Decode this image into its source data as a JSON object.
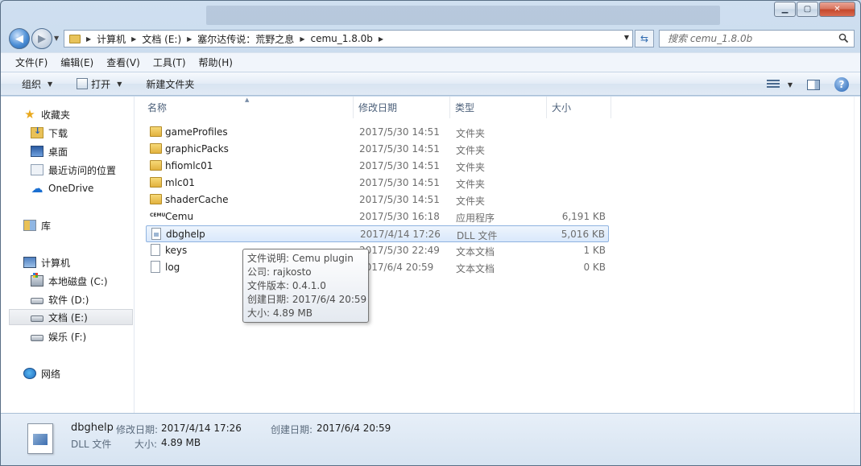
{
  "window": {
    "controls": {
      "minimize": "▁",
      "maximize": "▢",
      "close": "✕"
    }
  },
  "nav": {
    "back": "◀",
    "forward": "▶"
  },
  "address": {
    "crumbs": [
      "计算机",
      "文档 (E:)",
      "塞尔达传说：荒野之息",
      "cemu_1.8.0b"
    ]
  },
  "search": {
    "placeholder": "搜索 cemu_1.8.0b"
  },
  "menu": [
    "文件(F)",
    "编辑(E)",
    "查看(V)",
    "工具(T)",
    "帮助(H)"
  ],
  "toolbar": {
    "organize": "组织",
    "open": "打开",
    "new_folder": "新建文件夹"
  },
  "sidebar": {
    "favorites": "收藏夹",
    "downloads": "下载",
    "desktop": "桌面",
    "recent": "最近访问的位置",
    "onedrive": "OneDrive",
    "library": "库",
    "computer": "计算机",
    "drive_c": "本地磁盘 (C:)",
    "drive_d": "软件 (D:)",
    "drive_e": "文档 (E:)",
    "drive_f": "娱乐 (F:)",
    "network": "网络"
  },
  "columns": {
    "name": "名称",
    "date": "修改日期",
    "type": "类型",
    "size": "大小"
  },
  "files": [
    {
      "name": "gameProfiles",
      "date": "2017/5/30 14:51",
      "type": "文件夹",
      "size": "",
      "icon": "folder-icon"
    },
    {
      "name": "graphicPacks",
      "date": "2017/5/30 14:51",
      "type": "文件夹",
      "size": "",
      "icon": "folder-icon"
    },
    {
      "name": "hfiomlc01",
      "date": "2017/5/30 14:51",
      "type": "文件夹",
      "size": "",
      "icon": "folder-icon"
    },
    {
      "name": "mlc01",
      "date": "2017/5/30 14:51",
      "type": "文件夹",
      "size": "",
      "icon": "folder-icon"
    },
    {
      "name": "shaderCache",
      "date": "2017/5/30 14:51",
      "type": "文件夹",
      "size": "",
      "icon": "folder-icon"
    },
    {
      "name": "Cemu",
      "date": "2017/5/30 16:18",
      "type": "应用程序",
      "size": "6,191 KB",
      "icon": "cemu-app-icon"
    },
    {
      "name": "dbghelp",
      "date": "2017/4/14 17:26",
      "type": "DLL 文件",
      "size": "5,016 KB",
      "icon": "dll-file-icon"
    },
    {
      "name": "keys",
      "date": "2017/5/30 22:49",
      "type": "文本文档",
      "size": "1 KB",
      "icon": "text-file-icon"
    },
    {
      "name": "log",
      "date": "2017/6/4 20:59",
      "type": "文本文档",
      "size": "0 KB",
      "icon": "text-file-icon"
    }
  ],
  "tooltip": {
    "description": "文件说明: Cemu plugin",
    "company": "公司: rajkosto",
    "version": "文件版本: 0.4.1.0",
    "created": "创建日期: 2017/6/4 20:59",
    "size": "大小: 4.89 MB"
  },
  "details": {
    "name": "dbghelp",
    "type": "DLL 文件",
    "modified_label": "修改日期:",
    "modified_value": "2017/4/14 17:26",
    "created_label": "创建日期:",
    "created_value": "2017/6/4 20:59",
    "size_label": "大小:",
    "size_value": "4.89 MB"
  },
  "colors": {
    "selection": "#d9e8fb",
    "selection_border": "#8fb3e0",
    "chrome": "#bcd2e8"
  }
}
